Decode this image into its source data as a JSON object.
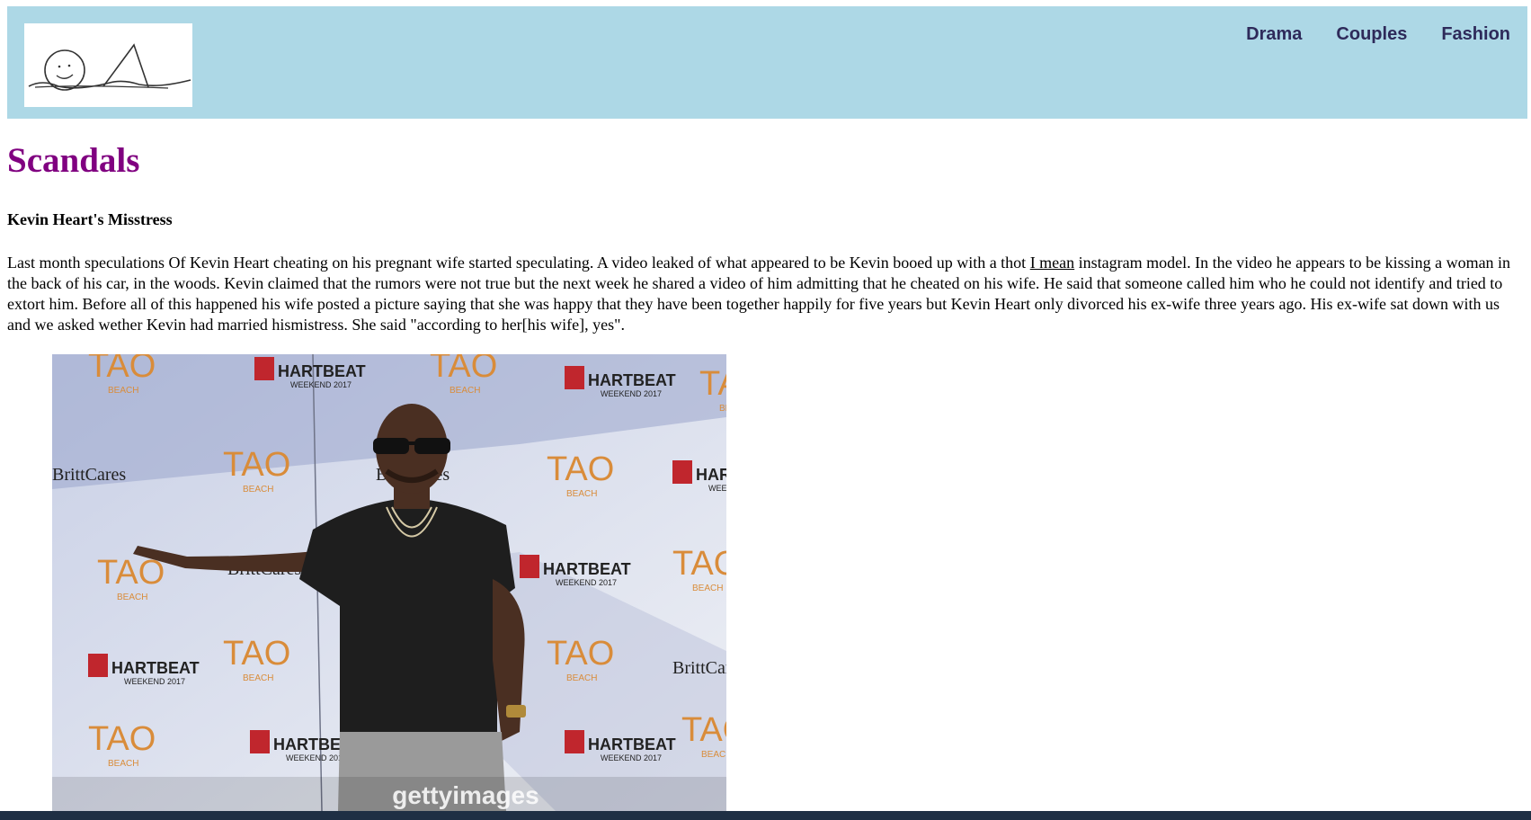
{
  "header": {
    "logo_alt": "site logo",
    "nav": [
      {
        "label": "Drama"
      },
      {
        "label": "Couples"
      },
      {
        "label": "Fashion"
      }
    ]
  },
  "page": {
    "title": "Scandals"
  },
  "article": {
    "title": "Kevin Heart's Misstress",
    "body_part1": "Last month speculations Of Kevin Heart cheating on his pregnant wife started speculating. A video leaked of what appeared to be Kevin booed up with a thot ",
    "link_text": "I mean",
    "body_part2": " instagram model. In the video he appears to be kissing a woman in the back of his car, in the woods. Kevin claimed that the rumors were not true but the next week he shared a video of him admitting that he cheated on his wife. He said that someone called him who he could not identify and tried to extort him. Before all of this happened his wife posted a picture saying that she was happy that they have been together happily for five years but Kevin Heart only divorced his ex-wife three years ago. His ex-wife sat down with us and we asked wether Kevin had married hismistress. She said \"according to her[his wife], yes\"."
  },
  "photo": {
    "backdrop_logos": [
      "TAO",
      "BEACH",
      "HARTBEAT",
      "WEEKEND 2017",
      "BrittCares"
    ],
    "watermark": "gettyimages",
    "colors": {
      "tao_orange": "#d98c3a",
      "hartbeat_red": "#c0262d",
      "shirt": "#1e1e1e"
    }
  }
}
